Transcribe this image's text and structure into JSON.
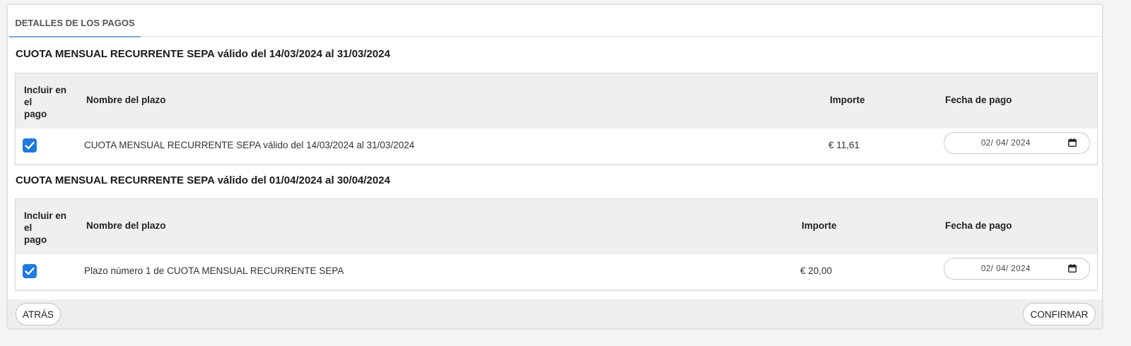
{
  "tab": {
    "label": "DETALLES DE LOS PAGOS"
  },
  "sections": [
    {
      "title": "CUOTA MENSUAL RECURRENTE SEPA válido del 14/03/2024 al 31/03/2024",
      "headers": {
        "include_lines": [
          "Incluir en",
          "el",
          "pago"
        ],
        "name": "Nombre del plazo",
        "amount": "Importe",
        "date": "Fecha de pago"
      },
      "row": {
        "checked": true,
        "name": "CUOTA MENSUAL RECURRENTE SEPA válido del 14/03/2024 al 31/03/2024",
        "amount": "€ 11,61",
        "date": "02/ 04/ 2024"
      }
    },
    {
      "title": "CUOTA MENSUAL RECURRENTE SEPA válido del 01/04/2024 al 30/04/2024",
      "headers": {
        "include_lines": [
          "Incluir en",
          "el",
          "pago"
        ],
        "name": "Nombre del plazo",
        "amount": "Importe",
        "date": "Fecha de pago"
      },
      "row": {
        "checked": true,
        "name": "Plazo número 1 de CUOTA MENSUAL RECURRENTE SEPA",
        "amount": "€ 20,00",
        "date": "02/ 04/ 2024"
      }
    }
  ],
  "footer": {
    "back_label": "ATRÁS",
    "confirm_label": "CONFIRMAR"
  },
  "colors": {
    "checkbox": "#1f7ae0",
    "tab_underline": "#7aa8d6",
    "header_bg": "#efefef"
  },
  "icons": {
    "checkbox": "check-icon",
    "date": "calendar-icon"
  }
}
